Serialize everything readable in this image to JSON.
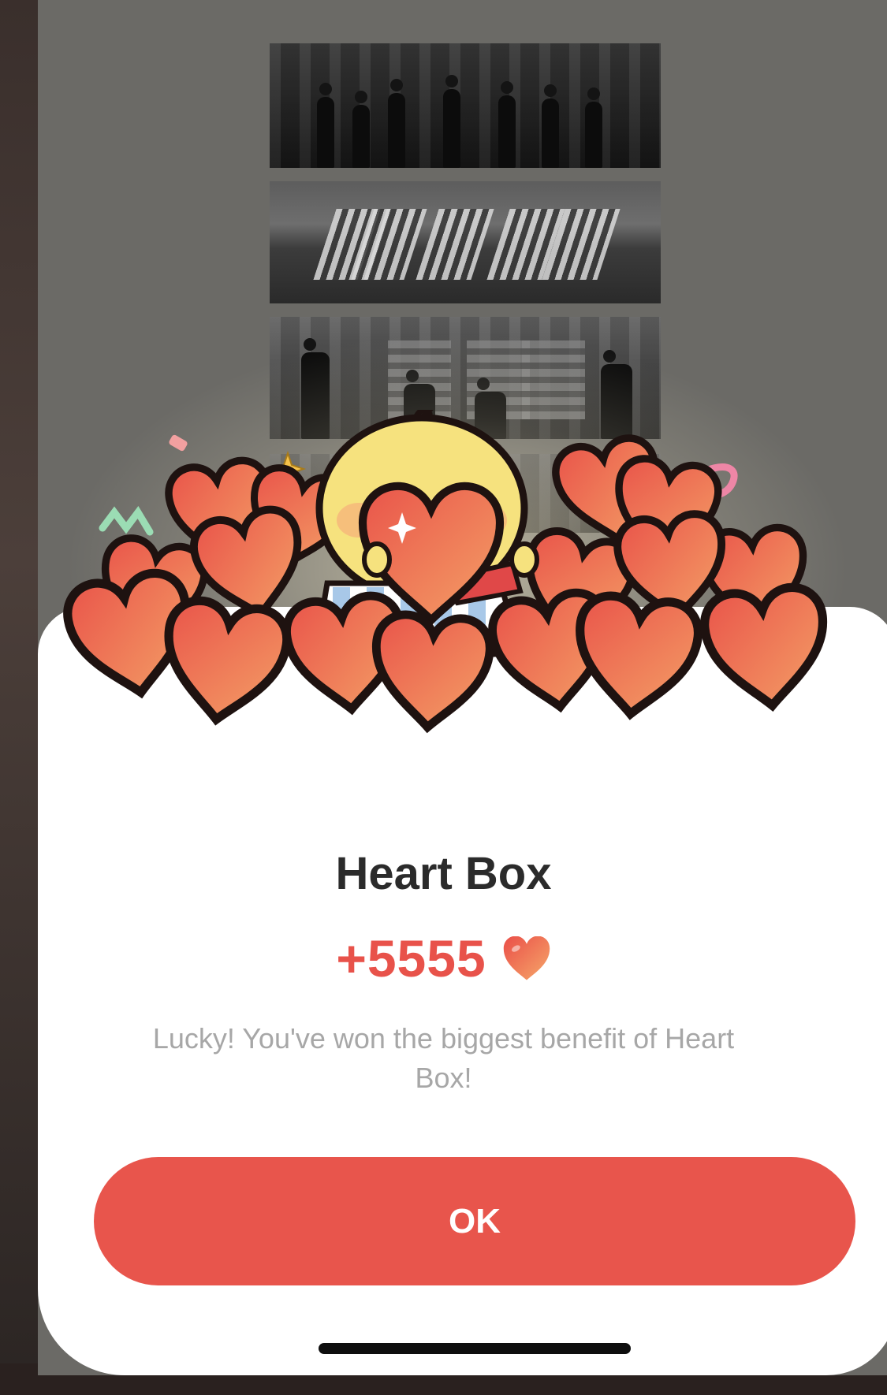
{
  "modal": {
    "title": "Heart Box",
    "amount": "+5555",
    "message": "Lucky! You've won the biggest benefit of Heart Box!",
    "ok_label": "OK"
  },
  "icons": {
    "reward_icon": "heart-icon",
    "mascot": "yellow-chick-mascot"
  },
  "colors": {
    "accent": "#e8554c",
    "amount": "#e8524a",
    "title": "#2b2b2b",
    "message": "#a7a7a7"
  }
}
